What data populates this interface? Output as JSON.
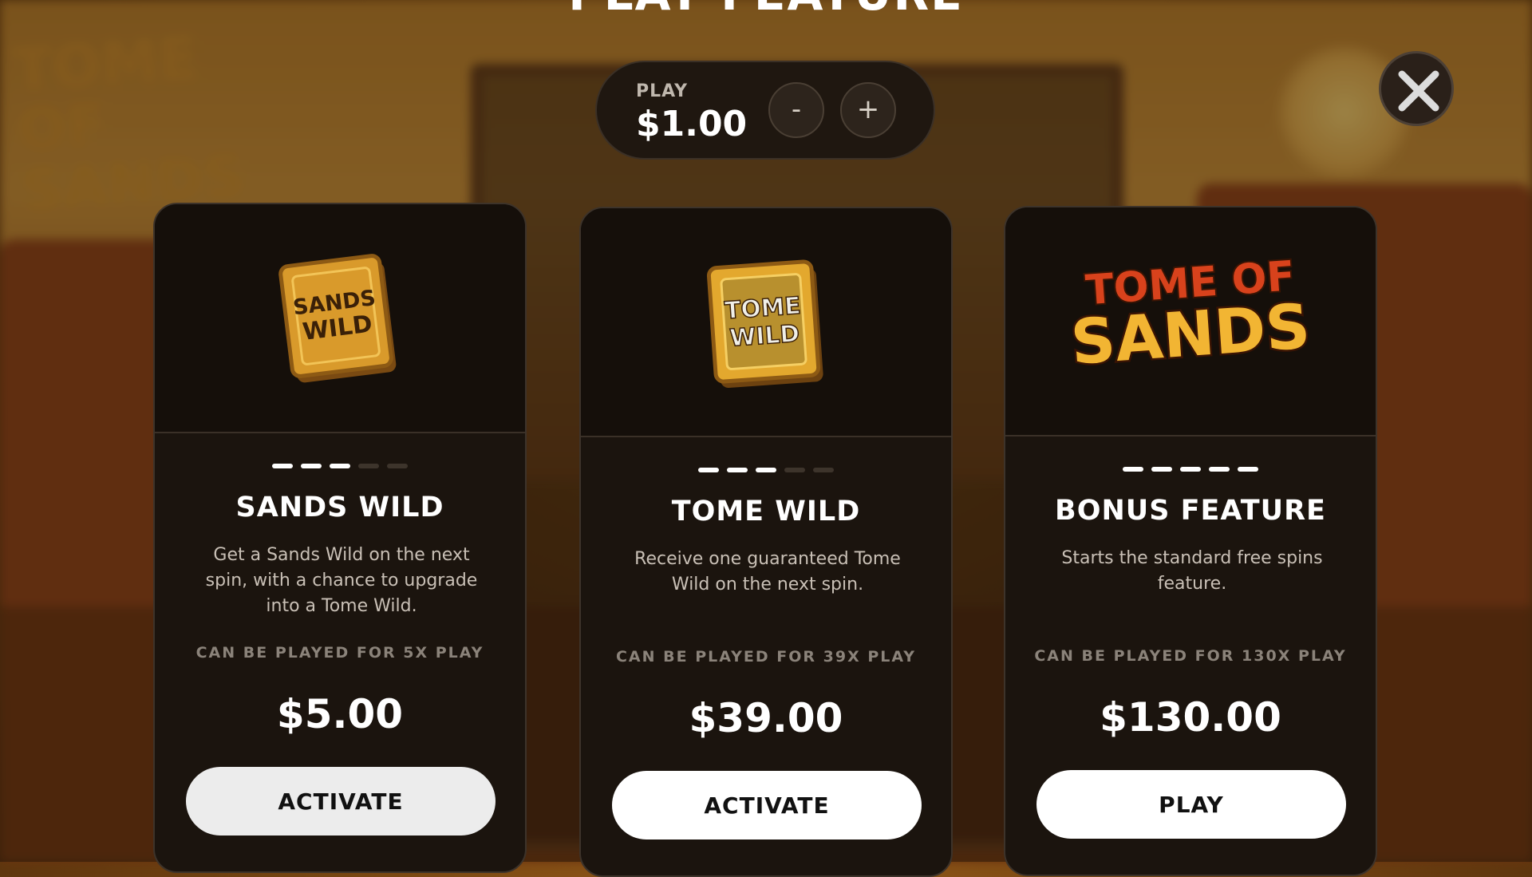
{
  "header": {
    "title": "PLAY FEATURE"
  },
  "background": {
    "logo_text": "TOME OF SANDS"
  },
  "stepper": {
    "label": "PLAY",
    "value": "$1.00",
    "minus": "-",
    "plus": "+"
  },
  "close": {
    "icon": "close-icon"
  },
  "cards": [
    {
      "title": "SANDS WILD",
      "description": "Get a Sands Wild on the next spin, with a chance to upgrade into a Tome Wild.",
      "cost_note": "CAN BE PLAYED FOR 5X PLAY",
      "price": "$5.00",
      "button": "ACTIVATE",
      "art_text": [
        "SANDS",
        "WILD"
      ],
      "level": 3,
      "level_max": 5
    },
    {
      "title": "TOME WILD",
      "description": "Receive one guaranteed Tome Wild on the next spin.",
      "cost_note": "CAN BE PLAYED FOR 39X PLAY",
      "price": "$39.00",
      "button": "ACTIVATE",
      "art_text": [
        "TOME",
        "WILD"
      ],
      "level": 3,
      "level_max": 5
    },
    {
      "title": "BONUS FEATURE",
      "description": "Starts the standard free spins feature.",
      "cost_note": "CAN BE PLAYED FOR 130X PLAY",
      "price": "$130.00",
      "button": "PLAY",
      "art_text": [
        "TOME OF",
        "SANDS"
      ],
      "level": 5,
      "level_max": 5
    }
  ],
  "colors": {
    "gold": "#e0a526",
    "card_bg": "#1b140e",
    "accent_red": "#d8421c"
  }
}
